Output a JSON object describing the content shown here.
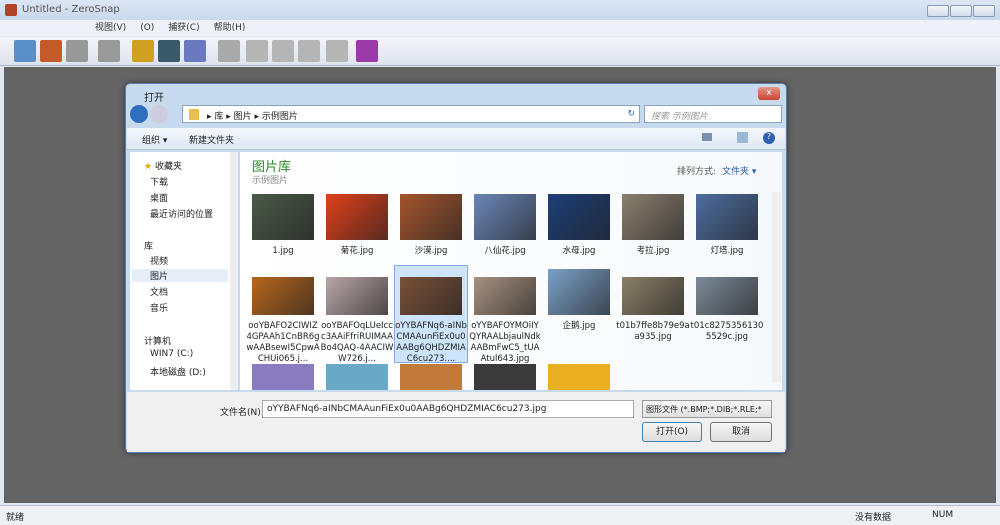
{
  "window": {
    "title": "Untitled - ZeroSnap"
  },
  "menu": [
    "视图(V)",
    "(O)",
    "捕获(C)",
    "帮助(H)"
  ],
  "toolbar_icons": [
    "new-icon",
    "save-icon",
    "stack-icon",
    "copy-icon",
    "pencil-icon",
    "monitor-icon",
    "window-capture-icon",
    "rotate-icon",
    "flip-left-icon",
    "flip-right-icon",
    "mirror-icon",
    "arrow-icon",
    "help-book-icon"
  ],
  "status": {
    "left": "就绪",
    "data": "没有数据",
    "num": "NUM"
  },
  "dialog": {
    "title": "打开",
    "close": "x",
    "breadcrumb": [
      "库",
      "图片",
      "示例图片"
    ],
    "search_placeholder": "搜索 示例图片",
    "organize": "组织 ▾",
    "new_folder": "新建文件夹",
    "library_title": "图片库",
    "library_sub": "示例图片",
    "sort_label": "排列方式:",
    "sort_value": "文件夹 ▾",
    "nav": {
      "favorites": "收藏夹",
      "downloads": "下载",
      "desktop": "桌面",
      "recent": "最近访问的位置",
      "libraries": "库",
      "videos": "视频",
      "pictures": "图片",
      "documents": "文档",
      "music": "音乐",
      "computer": "计算机",
      "c_drive": "WIN7 (C:)",
      "d_drive": "本地磁盘 (D:)"
    },
    "files": [
      {
        "name": "1.jpg",
        "color": "#4a5a48"
      },
      {
        "name": "菊花.jpg",
        "color": "#e0401a"
      },
      {
        "name": "沙漠.jpg",
        "color": "#a4552c"
      },
      {
        "name": "八仙花.jpg",
        "color": "#6a86b8"
      },
      {
        "name": "水母.jpg",
        "color": "#1d3e78"
      },
      {
        "name": "考拉.jpg",
        "color": "#8b8070"
      },
      {
        "name": "灯塔.jpg",
        "color": "#4d6da0"
      },
      {
        "name": "ooYBAFO2CIWIZ4GPAAh1CnBR6gwAABsewI5CpwACHUi065.j...",
        "color": "#b8661c"
      },
      {
        "name": "ooYBAFOqLUeIccc3AAiFfriRUIMAABo4QAQ-4AACIWW726.j...",
        "color": "#b9a6a8"
      },
      {
        "name": "oYYBAFNq6-aINbCMAAunFiEx0u0AABg6QHDZMIAC6cu273....",
        "color": "#7a5038"
      },
      {
        "name": "oYYBAFOYMOiIYQYRAALbjaulNdkAABmFwC5_tUAAtul643.jpg",
        "color": "#a89282"
      },
      {
        "name": "企鹅.jpg",
        "color": "#7aa0c8"
      },
      {
        "name": "t01b7ffe8b79e9aa935.jpg",
        "color": "#8a8068"
      },
      {
        "name": "t01c82753561305529c.jpg",
        "color": "#7c8a98"
      }
    ],
    "filename_label": "文件名(N):",
    "filename_value": "oYYBAFNq6-aINbCMAAunFiEx0u0AABg6QHDZMIAC6cu273.jpg",
    "filetype": "图形文件 (*.BMP;*.DIB;*.RLE;*",
    "open": "打开(O)",
    "cancel": "取消"
  }
}
